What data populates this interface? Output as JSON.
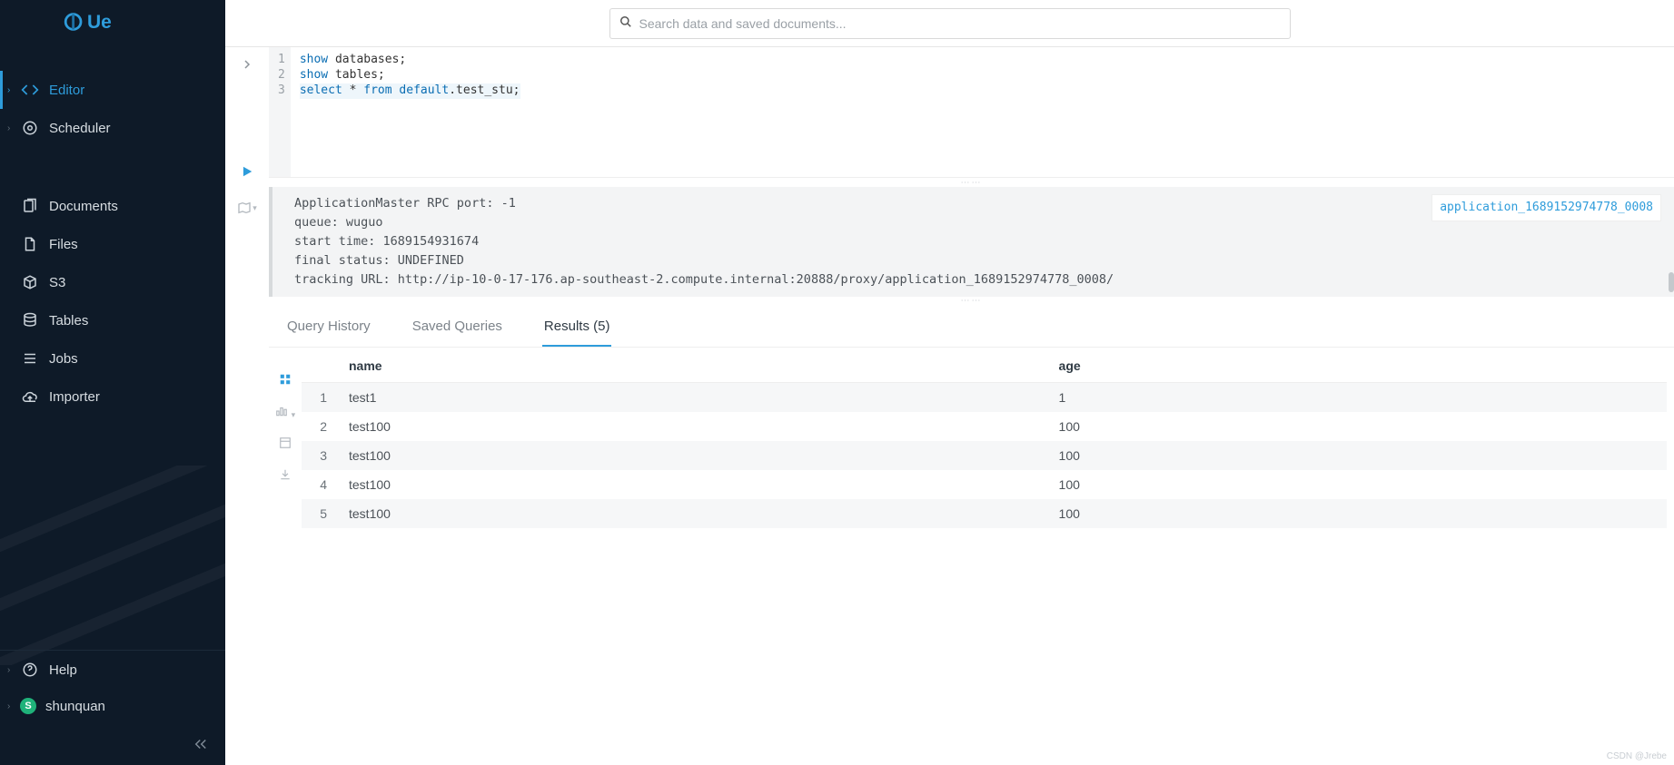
{
  "brand": {
    "name": "Hue"
  },
  "search": {
    "placeholder": "Search data and saved documents..."
  },
  "sidebar": {
    "primary": [
      {
        "label": "Editor",
        "icon": "code-icon",
        "active": true,
        "expandable": true
      },
      {
        "label": "Scheduler",
        "icon": "target-icon",
        "active": false,
        "expandable": true
      }
    ],
    "secondary": [
      {
        "label": "Documents",
        "icon": "documents-icon"
      },
      {
        "label": "Files",
        "icon": "files-icon"
      },
      {
        "label": "S3",
        "icon": "s3-icon"
      },
      {
        "label": "Tables",
        "icon": "tables-icon"
      },
      {
        "label": "Jobs",
        "icon": "jobs-icon"
      },
      {
        "label": "Importer",
        "icon": "importer-icon"
      }
    ],
    "bottom": {
      "help": "Help",
      "user": "shunquan",
      "user_initial": "S"
    }
  },
  "editor": {
    "lines": [
      {
        "n": 1,
        "tokens": [
          {
            "t": "show",
            "c": "kw"
          },
          {
            "t": " databases;",
            "c": ""
          }
        ]
      },
      {
        "n": 2,
        "tokens": [
          {
            "t": "show",
            "c": "kw"
          },
          {
            "t": " tables;",
            "c": ""
          }
        ]
      },
      {
        "n": 3,
        "tokens": [
          {
            "t": "select",
            "c": "kw"
          },
          {
            "t": " * ",
            "c": ""
          },
          {
            "t": "from",
            "c": "kw"
          },
          {
            "t": " default",
            "c": "kw"
          },
          {
            "t": ".test_stu;",
            "c": "tbl"
          }
        ]
      }
    ]
  },
  "log": {
    "lines": [
      "ApplicationMaster RPC port: -1",
      "queue: wuguo",
      "start time: 1689154931674",
      "final status: UNDEFINED",
      "tracking URL: http://ip-10-0-17-176.ap-southeast-2.compute.internal:20888/proxy/application_1689152974778_0008/"
    ],
    "app_link": "application_1689152974778_0008"
  },
  "tabs": {
    "history": "Query History",
    "saved": "Saved Queries",
    "results": "Results (5)"
  },
  "results": {
    "columns": [
      "",
      "name",
      "age"
    ],
    "rows": [
      {
        "idx": 1,
        "name": "test1",
        "age": "1"
      },
      {
        "idx": 2,
        "name": "test100",
        "age": "100"
      },
      {
        "idx": 3,
        "name": "test100",
        "age": "100"
      },
      {
        "idx": 4,
        "name": "test100",
        "age": "100"
      },
      {
        "idx": 5,
        "name": "test100",
        "age": "100"
      }
    ]
  },
  "watermark": "CSDN @Jrebe"
}
